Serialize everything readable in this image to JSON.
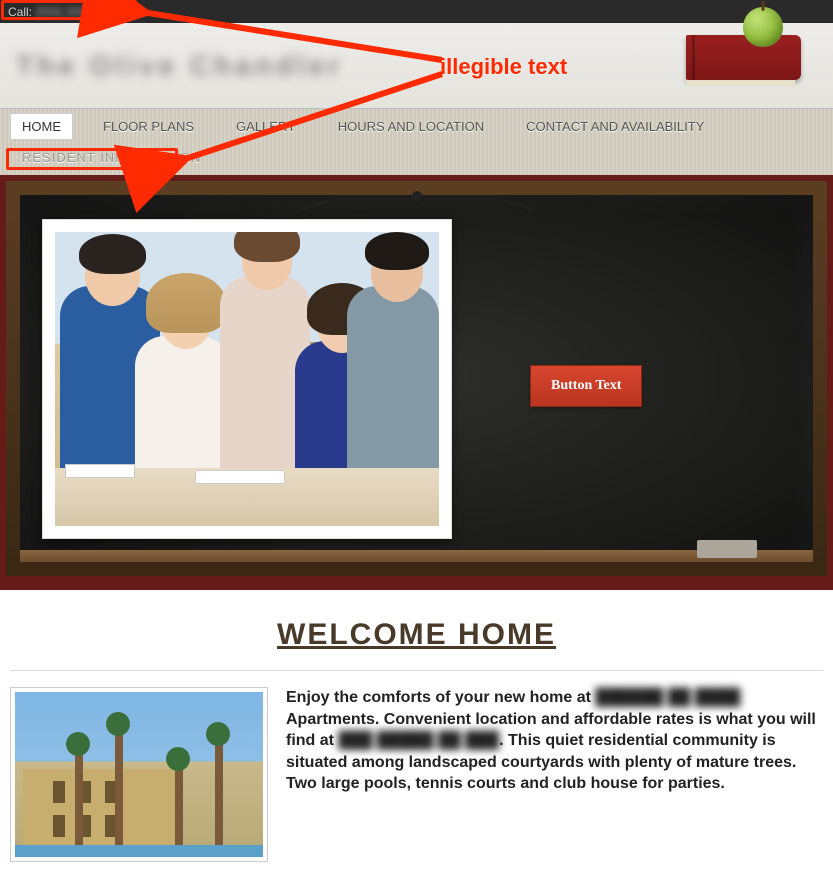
{
  "topbar": {
    "call_prefix": "Call:",
    "call_number_hidden": "(555) 555-5555"
  },
  "header": {
    "title_hidden": "The Olive Chandler"
  },
  "nav": {
    "items": [
      {
        "label": "HOME",
        "active": true
      },
      {
        "label": "FLOOR PLANS"
      },
      {
        "label": "GALLERY"
      },
      {
        "label": "HOURS AND LOCATION"
      },
      {
        "label": "CONTACT AND AVAILABILITY"
      }
    ],
    "secondary": [
      {
        "label": "RESIDENT INFORMATION"
      }
    ]
  },
  "hero": {
    "button_label": "Button Text"
  },
  "annotation": {
    "label": "illegible text"
  },
  "content": {
    "welcome_heading": "WELCOME HOME",
    "copy_parts": {
      "p1a": "Enjoy the comforts of your new home at ",
      "p1blur1": "██████ ██ ████",
      "p1b": " Apartments. Convenient location and affordable rates is what you will find at ",
      "p1blur2": "███ █████ ██ ███",
      "p1c": ". This quiet residential community is situated among landscaped courtyards with plenty of mature trees. Two large pools, tennis courts and club house for parties."
    }
  }
}
